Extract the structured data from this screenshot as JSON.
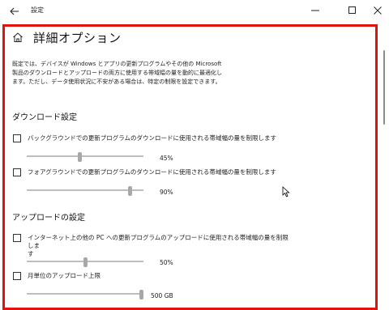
{
  "window": {
    "title": "設定",
    "back_icon": "back-arrow-icon",
    "minimize_icon": "minimize-icon",
    "maximize_icon": "maximize-icon",
    "close_icon": "close-icon"
  },
  "page": {
    "home_icon": "home-icon",
    "title": "詳細オプション",
    "description_lines": [
      "既定では、デバイスが Windows とアプリの更新プログラムやその他の Microsoft",
      "製品のダウンロードとアップロードの両方に使用する帯域幅の量を動的に最適化し",
      "ます。ただし、データ使用状況に不安がある場合は、特定の制限を設定できます。"
    ]
  },
  "download": {
    "section_title": "ダウンロード設定",
    "background": {
      "label": "バックグラウンドでの更新プログラムのダウンロードに使用される帯域幅の量を制限します",
      "checked": false,
      "value_percent": 45,
      "value_text": "45%"
    },
    "foreground": {
      "label": "フォアグラウンドでの更新プログラムのダウンロードに使用される帯域幅の量を制限します",
      "checked": false,
      "value_percent": 90,
      "value_text": "90%"
    }
  },
  "upload": {
    "section_title": "アップロードの設定",
    "internet_pc": {
      "label_line1": "インターネット上の他の PC への更新プログラムのアップロードに使用される帯域幅の量を制限しま",
      "label_line2": "す",
      "checked": false,
      "value_percent": 50,
      "value_text": "50%"
    },
    "monthly_limit": {
      "label": "月単位のアップロード上限",
      "checked": false,
      "value_fraction": 1.0,
      "value_text": "500 GB"
    }
  },
  "colors": {
    "highlight_border": "#e3120b",
    "slider_track": "#bdbdbd",
    "slider_thumb": "#a8a8a8"
  }
}
